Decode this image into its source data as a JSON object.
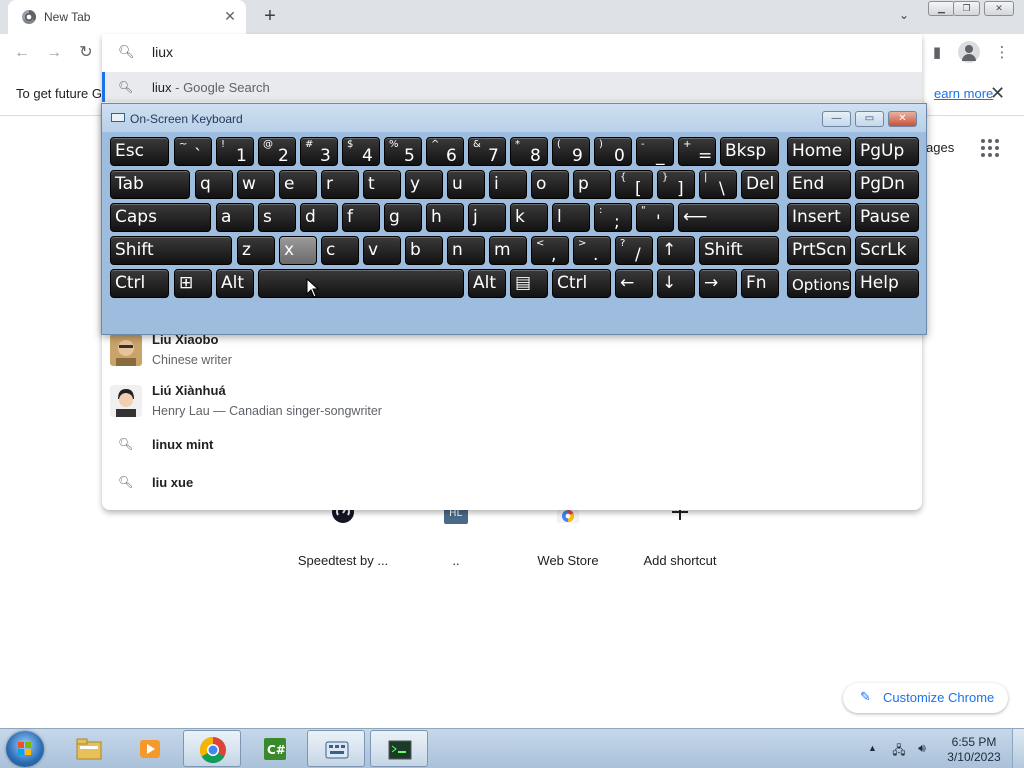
{
  "browser": {
    "tab": {
      "title": "New Tab",
      "close": "✕"
    },
    "new_tab": "+",
    "tab_search": "⌄",
    "window_controls": [
      "▁",
      "❐",
      "✕"
    ],
    "nav": {
      "back": "←",
      "forward": "→",
      "reload": "↻"
    },
    "toolbar_icons": {
      "sidepanel": "▮",
      "menu": "⋮"
    }
  },
  "infobar": {
    "text": "To get future G",
    "link": "earn more",
    "close": "✕"
  },
  "omnibox": {
    "query": "liux",
    "suggestions": [
      {
        "type": "search",
        "title_bold": "liux",
        "title_rest": " - Google Search",
        "selected": true
      },
      {
        "type": "entity",
        "title_bold": "Liu Xiaobo",
        "subtitle": "Chinese writer"
      },
      {
        "type": "entity",
        "title_bold": "Liú Xiànhuá",
        "subtitle": "Henry Lau — Canadian singer-songwriter"
      },
      {
        "type": "search",
        "title_bold": "linux mint"
      },
      {
        "type": "search",
        "title_bold": "liu xue"
      }
    ]
  },
  "ntp": {
    "images_link": "ages",
    "shortcuts": [
      {
        "label": "Speedtest by ...",
        "icon": "speedtest-icon"
      },
      {
        "label": "..",
        "icon": "hl-icon"
      },
      {
        "label": "Web Store",
        "icon": "web-store-icon"
      },
      {
        "label": "Add shortcut",
        "icon": "plus-icon"
      }
    ],
    "customize_label": "Customize Chrome"
  },
  "osk": {
    "title": "On-Screen Keyboard",
    "controls": [
      "—",
      "▭",
      "✕"
    ],
    "rows": [
      [
        {
          "l": "Esc"
        },
        {
          "s": "~",
          "p": "`"
        },
        {
          "s": "!",
          "p": "1"
        },
        {
          "s": "@",
          "p": "2"
        },
        {
          "s": "#",
          "p": "3"
        },
        {
          "s": "$",
          "p": "4"
        },
        {
          "s": "%",
          "p": "5"
        },
        {
          "s": "^",
          "p": "6"
        },
        {
          "s": "&",
          "p": "7"
        },
        {
          "s": "*",
          "p": "8"
        },
        {
          "s": "(",
          "p": "9"
        },
        {
          "s": ")",
          "p": "0"
        },
        {
          "s": "-",
          "p": "_"
        },
        {
          "s": "+",
          "p": "="
        },
        {
          "l": "Bksp"
        },
        {
          "l": "Home"
        },
        {
          "l": "PgUp"
        }
      ],
      [
        {
          "l": "Tab"
        },
        {
          "l": "q"
        },
        {
          "l": "w"
        },
        {
          "l": "e"
        },
        {
          "l": "r"
        },
        {
          "l": "t"
        },
        {
          "l": "y"
        },
        {
          "l": "u"
        },
        {
          "l": "i"
        },
        {
          "l": "o"
        },
        {
          "l": "p"
        },
        {
          "s": "{",
          "p": "["
        },
        {
          "s": "}",
          "p": "]"
        },
        {
          "s": "|",
          "p": "\\"
        },
        {
          "l": "Del"
        },
        {
          "l": "End"
        },
        {
          "l": "PgDn"
        }
      ],
      [
        {
          "l": "Caps"
        },
        {
          "l": "a"
        },
        {
          "l": "s"
        },
        {
          "l": "d"
        },
        {
          "l": "f"
        },
        {
          "l": "g"
        },
        {
          "l": "h"
        },
        {
          "l": "j"
        },
        {
          "l": "k"
        },
        {
          "l": "l"
        },
        {
          "s": ":",
          "p": ";"
        },
        {
          "s": "\"",
          "p": "'"
        },
        {
          "l": "⟵"
        },
        {
          "l": "Insert"
        },
        {
          "l": "Pause"
        }
      ],
      [
        {
          "l": "Shift"
        },
        {
          "l": "z"
        },
        {
          "l": "x",
          "hl": true
        },
        {
          "l": "c"
        },
        {
          "l": "v"
        },
        {
          "l": "b"
        },
        {
          "l": "n"
        },
        {
          "l": "m"
        },
        {
          "s": "<",
          "p": ","
        },
        {
          "s": ">",
          "p": "."
        },
        {
          "s": "?",
          "p": "/"
        },
        {
          "l": "↑"
        },
        {
          "l": "Shift"
        },
        {
          "l": "PrtScn"
        },
        {
          "l": "ScrLk"
        }
      ],
      [
        {
          "l": "Ctrl"
        },
        {
          "l": "⊞"
        },
        {
          "l": "Alt"
        },
        {
          "l": ""
        },
        {
          "l": "Alt"
        },
        {
          "l": "▤"
        },
        {
          "l": "Ctrl"
        },
        {
          "l": "←"
        },
        {
          "l": "↓"
        },
        {
          "l": "→"
        },
        {
          "l": "Fn"
        },
        {
          "l": "Options",
          "small": true
        },
        {
          "l": "Help"
        }
      ]
    ]
  },
  "taskbar": {
    "items": [
      "explorer-icon",
      "media-player-icon",
      "chrome-icon",
      "csharp-icon",
      "osk-icon",
      "terminal-icon"
    ],
    "time": "6:55 PM",
    "date": "3/10/2023"
  },
  "colors": {
    "accent": "#1a73e8",
    "osk_bg": "#9ebcdd",
    "taskbar": "#b8cee4"
  }
}
